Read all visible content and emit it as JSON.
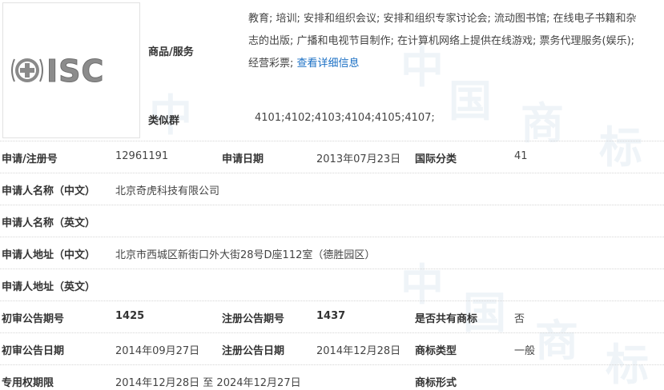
{
  "watermark": "中国商标",
  "logo": {
    "text": "ISC"
  },
  "goods": {
    "label": "商品/服务",
    "lines": [
      "教育; 培训; 安排和组织会议; 安排和组织专家讨论会; 流动图书馆; 在线电子书籍和杂",
      "志的出版; 广播和电视节目制作; 在计算机网络上提供在线游戏; 票务代理服务(娱乐);",
      "经营彩票; "
    ],
    "detail_link": "查看详细信息"
  },
  "similar_group": {
    "label": "类似群",
    "value": "4101;4102;4103;4104;4105;4107;"
  },
  "rows": {
    "reg_no_label": "申请/注册号",
    "reg_no": "12961191",
    "apply_date_label": "申请日期",
    "apply_date": "2013年07月23日",
    "intl_class_label": "国际分类",
    "intl_class": "41",
    "applicant_cn_label": "申请人名称（中文）",
    "applicant_cn": "北京奇虎科技有限公司",
    "applicant_en_label": "申请人名称（英文）",
    "applicant_en": "",
    "address_cn_label": "申请人地址（中文）",
    "address_cn": "北京市西城区新街口外大街28号D座112室（德胜园区）",
    "address_en_label": "申请人地址（英文）",
    "address_en": "",
    "prelim_no_label": "初审公告期号",
    "prelim_no": "1425",
    "reg_pub_no_label": "注册公告期号",
    "reg_pub_no": "1437",
    "shared_label": "是否共有商标",
    "shared": "否",
    "prelim_date_label": "初审公告日期",
    "prelim_date": "2014年09月27日",
    "reg_pub_date_label": "注册公告日期",
    "reg_pub_date": "2014年12月28日",
    "tm_type_label": "商标类型",
    "tm_type": "一般",
    "exclusive_label": "专用权期限",
    "exclusive": "2014年12月28日 至 2024年12月27日",
    "tm_form_label": "商标形式",
    "tm_form": ""
  }
}
